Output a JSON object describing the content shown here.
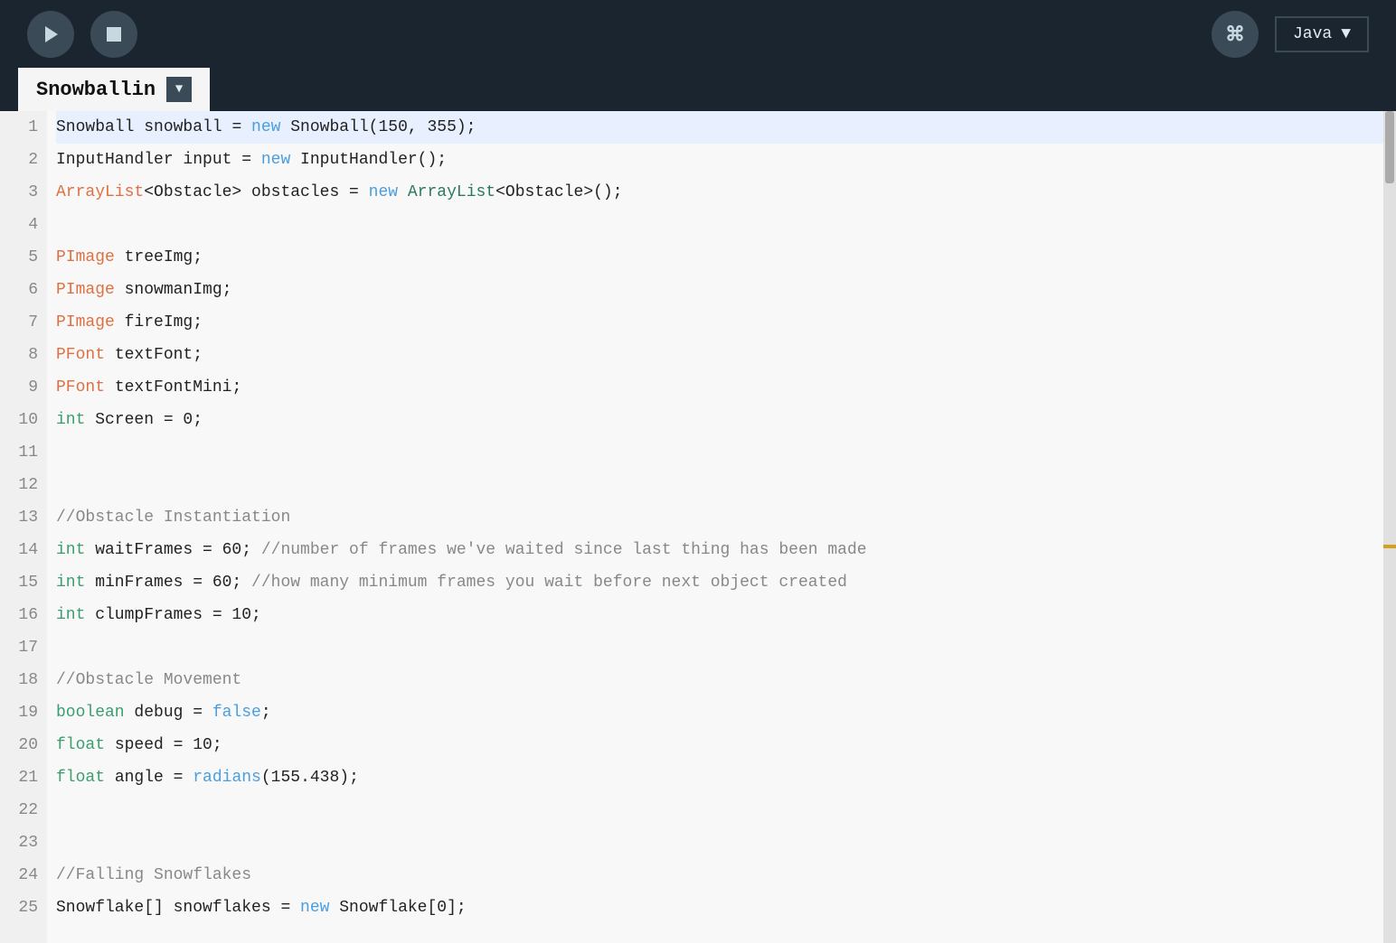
{
  "toolbar": {
    "play_label": "▶",
    "stop_label": "■",
    "cmd_label": "⌘",
    "lang_label": "Java",
    "lang_arrow": "▼"
  },
  "tab": {
    "name": "Snowballin",
    "arrow": "▼"
  },
  "lines": [
    {
      "num": 1,
      "highlighted": true,
      "parts": [
        {
          "text": "Snowball",
          "class": "normal"
        },
        {
          "text": " snowball = ",
          "class": "normal"
        },
        {
          "text": "new",
          "class": "kw-new"
        },
        {
          "text": " Snowball(150, 355);",
          "class": "normal"
        }
      ]
    },
    {
      "num": 2,
      "highlighted": false,
      "parts": [
        {
          "text": "InputHandler input = ",
          "class": "normal"
        },
        {
          "text": "new",
          "class": "kw-new"
        },
        {
          "text": " InputHandler();",
          "class": "normal"
        }
      ]
    },
    {
      "num": 3,
      "highlighted": false,
      "parts": [
        {
          "text": "ArrayList",
          "class": "orange-type"
        },
        {
          "text": "<Obstacle> obstacles = ",
          "class": "normal"
        },
        {
          "text": "new",
          "class": "kw-new"
        },
        {
          "text": " ArrayList",
          "class": "kw-class"
        },
        {
          "text": "<Obstacle>();",
          "class": "normal"
        }
      ]
    },
    {
      "num": 4,
      "highlighted": false,
      "parts": []
    },
    {
      "num": 5,
      "highlighted": false,
      "parts": [
        {
          "text": "PImage",
          "class": "orange-type"
        },
        {
          "text": " treeImg;",
          "class": "normal"
        }
      ]
    },
    {
      "num": 6,
      "highlighted": false,
      "parts": [
        {
          "text": "PImage",
          "class": "orange-type"
        },
        {
          "text": " snowmanImg;",
          "class": "normal"
        }
      ]
    },
    {
      "num": 7,
      "highlighted": false,
      "parts": [
        {
          "text": "PImage",
          "class": "orange-type"
        },
        {
          "text": " fireImg;",
          "class": "normal"
        }
      ]
    },
    {
      "num": 8,
      "highlighted": false,
      "parts": [
        {
          "text": "PFont",
          "class": "orange-type"
        },
        {
          "text": " textFont;",
          "class": "normal"
        }
      ]
    },
    {
      "num": 9,
      "highlighted": false,
      "parts": [
        {
          "text": "PFont",
          "class": "orange-type"
        },
        {
          "text": " textFontMini;",
          "class": "normal"
        }
      ]
    },
    {
      "num": 10,
      "highlighted": false,
      "parts": [
        {
          "text": "int",
          "class": "kw-int"
        },
        {
          "text": " Screen = 0;",
          "class": "normal"
        }
      ]
    },
    {
      "num": 11,
      "highlighted": false,
      "parts": []
    },
    {
      "num": 12,
      "highlighted": false,
      "parts": []
    },
    {
      "num": 13,
      "highlighted": false,
      "parts": [
        {
          "text": "//Obstacle Instantiation",
          "class": "comment"
        }
      ]
    },
    {
      "num": 14,
      "highlighted": false,
      "parts": [
        {
          "text": "int",
          "class": "kw-int"
        },
        {
          "text": " waitFrames = 60; ",
          "class": "normal"
        },
        {
          "text": "//number of frames we've waited since last thing has been made",
          "class": "comment"
        }
      ]
    },
    {
      "num": 15,
      "highlighted": false,
      "parts": [
        {
          "text": "int",
          "class": "kw-int"
        },
        {
          "text": " minFrames = 60; ",
          "class": "normal"
        },
        {
          "text": "//how many minimum frames you wait before next object created",
          "class": "comment"
        }
      ]
    },
    {
      "num": 16,
      "highlighted": false,
      "parts": [
        {
          "text": "int",
          "class": "kw-int"
        },
        {
          "text": " clumpFrames = 10;",
          "class": "normal"
        }
      ]
    },
    {
      "num": 17,
      "highlighted": false,
      "parts": []
    },
    {
      "num": 18,
      "highlighted": false,
      "parts": [
        {
          "text": "//Obstacle Movement",
          "class": "comment"
        }
      ]
    },
    {
      "num": 19,
      "highlighted": false,
      "parts": [
        {
          "text": "boolean",
          "class": "kw-int"
        },
        {
          "text": " debug = ",
          "class": "normal"
        },
        {
          "text": "false",
          "class": "kw-false"
        },
        {
          "text": ";",
          "class": "normal"
        }
      ]
    },
    {
      "num": 20,
      "highlighted": false,
      "parts": [
        {
          "text": "float",
          "class": "kw-int"
        },
        {
          "text": " speed = 10;",
          "class": "normal"
        }
      ]
    },
    {
      "num": 21,
      "highlighted": false,
      "parts": [
        {
          "text": "float",
          "class": "kw-int"
        },
        {
          "text": " angle = ",
          "class": "normal"
        },
        {
          "text": "radians",
          "class": "kw-radians"
        },
        {
          "text": "(155.438);",
          "class": "normal"
        }
      ]
    },
    {
      "num": 22,
      "highlighted": false,
      "parts": []
    },
    {
      "num": 23,
      "highlighted": false,
      "parts": []
    },
    {
      "num": 24,
      "highlighted": false,
      "parts": [
        {
          "text": "//Falling Snowflakes",
          "class": "comment"
        }
      ]
    },
    {
      "num": 25,
      "highlighted": false,
      "parts": [
        {
          "text": "Snowflake[] snowflakes = ",
          "class": "normal"
        },
        {
          "text": "new",
          "class": "kw-new"
        },
        {
          "text": " Snowflake[0];",
          "class": "normal"
        }
      ]
    }
  ]
}
